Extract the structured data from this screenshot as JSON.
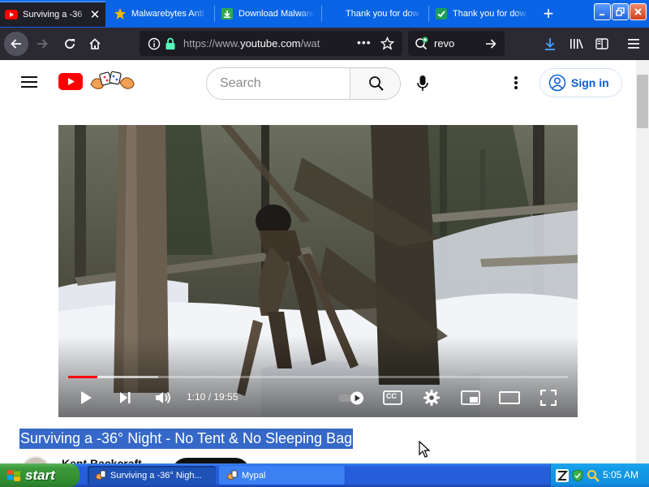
{
  "browser": {
    "tabs": [
      {
        "label": "Surviving a -36",
        "active": true,
        "favicon": "youtube-favicon"
      },
      {
        "label": "Malwarebytes Anti",
        "active": false,
        "favicon": "star-favicon"
      },
      {
        "label": "Download Malware",
        "active": false,
        "favicon": "download-favicon"
      },
      {
        "label": "Thank you for dow",
        "active": false,
        "favicon": "none"
      },
      {
        "label": "Thank you for dow",
        "active": false,
        "favicon": "green-check-favicon"
      }
    ],
    "url_prefix": "https://www.",
    "url_domain": "youtube.com",
    "url_suffix": "/wat",
    "search_value": "revo",
    "accent": "#0a64e6"
  },
  "youtube": {
    "search_placeholder": "Search",
    "signin_label": "Sign in",
    "video": {
      "time_text": "1:10 / 19:55",
      "progress": 0.059,
      "buffered": 0.18,
      "title": "Surviving a -36° Night - No Tent & No Sleeping Bag",
      "cc_label": "CC"
    },
    "channel_name": "Kent Backcraft"
  },
  "taskbar": {
    "start_label": "start",
    "buttons": [
      {
        "label": "Surviving a -36° Nigh...",
        "active": true
      },
      {
        "label": "Mypal",
        "active": false
      }
    ],
    "clock": "5:05 AM"
  }
}
